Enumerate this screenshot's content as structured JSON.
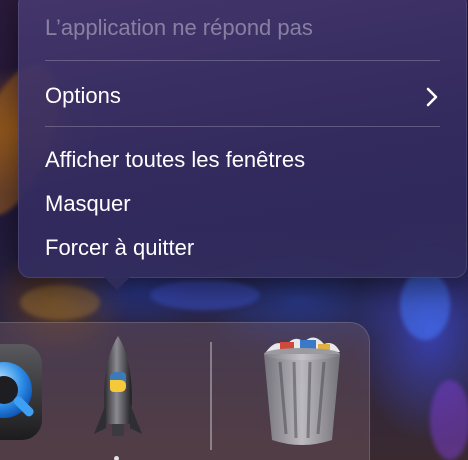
{
  "menu": {
    "status_label": "L’application ne répond pas",
    "items": [
      {
        "label": "Options",
        "has_submenu": true
      },
      {
        "label": "Afficher toutes les fenêtres"
      },
      {
        "label": "Masquer"
      },
      {
        "label": "Forcer à quitter"
      }
    ]
  },
  "dock": {
    "apps": [
      {
        "name": "quicktime-icon"
      },
      {
        "name": "python-launcher-icon",
        "running": true
      },
      {
        "name": "trash-full-icon"
      }
    ]
  },
  "colors": {
    "menu_bg": "#34305e",
    "disabled_text": "#8f8ca6",
    "text": "#ffffff"
  }
}
